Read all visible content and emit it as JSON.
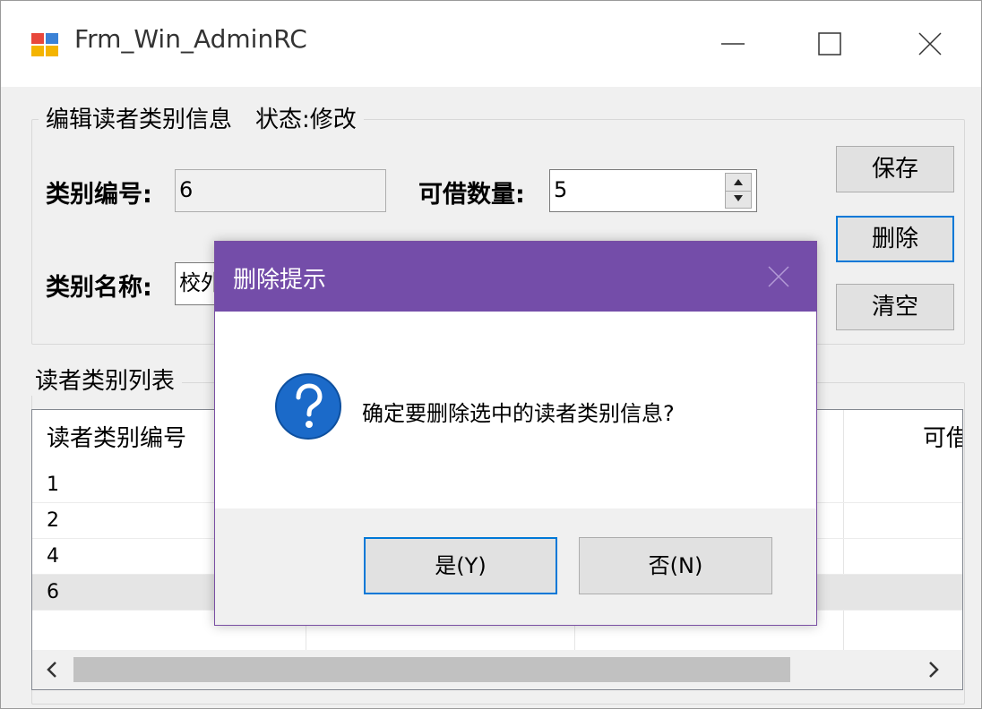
{
  "window": {
    "title": "Frm_Win_AdminRC"
  },
  "edit_group": {
    "legend": "编辑读者类别信息",
    "status": "状态:修改",
    "id_label": "类别编号:",
    "id_value": "6",
    "count_label": "可借数量:",
    "count_value": "5",
    "name_label": "类别名称:",
    "name_value": "校外"
  },
  "buttons": {
    "save": "保存",
    "delete": "删除",
    "clear": "清空"
  },
  "list_group": {
    "legend": "读者类别列表",
    "headers": [
      "读者类别编号",
      "可借"
    ],
    "rows": [
      "1",
      "2",
      "4",
      "6"
    ]
  },
  "dialog": {
    "title": "删除提示",
    "message": "确定要删除选中的读者类别信息?",
    "yes": "是(Y)",
    "no": "否(N)"
  },
  "colors": {
    "dialog_title_bg": "#744da9",
    "focus_border": "#0078d7",
    "icon_blue": "#1b6ac9"
  }
}
